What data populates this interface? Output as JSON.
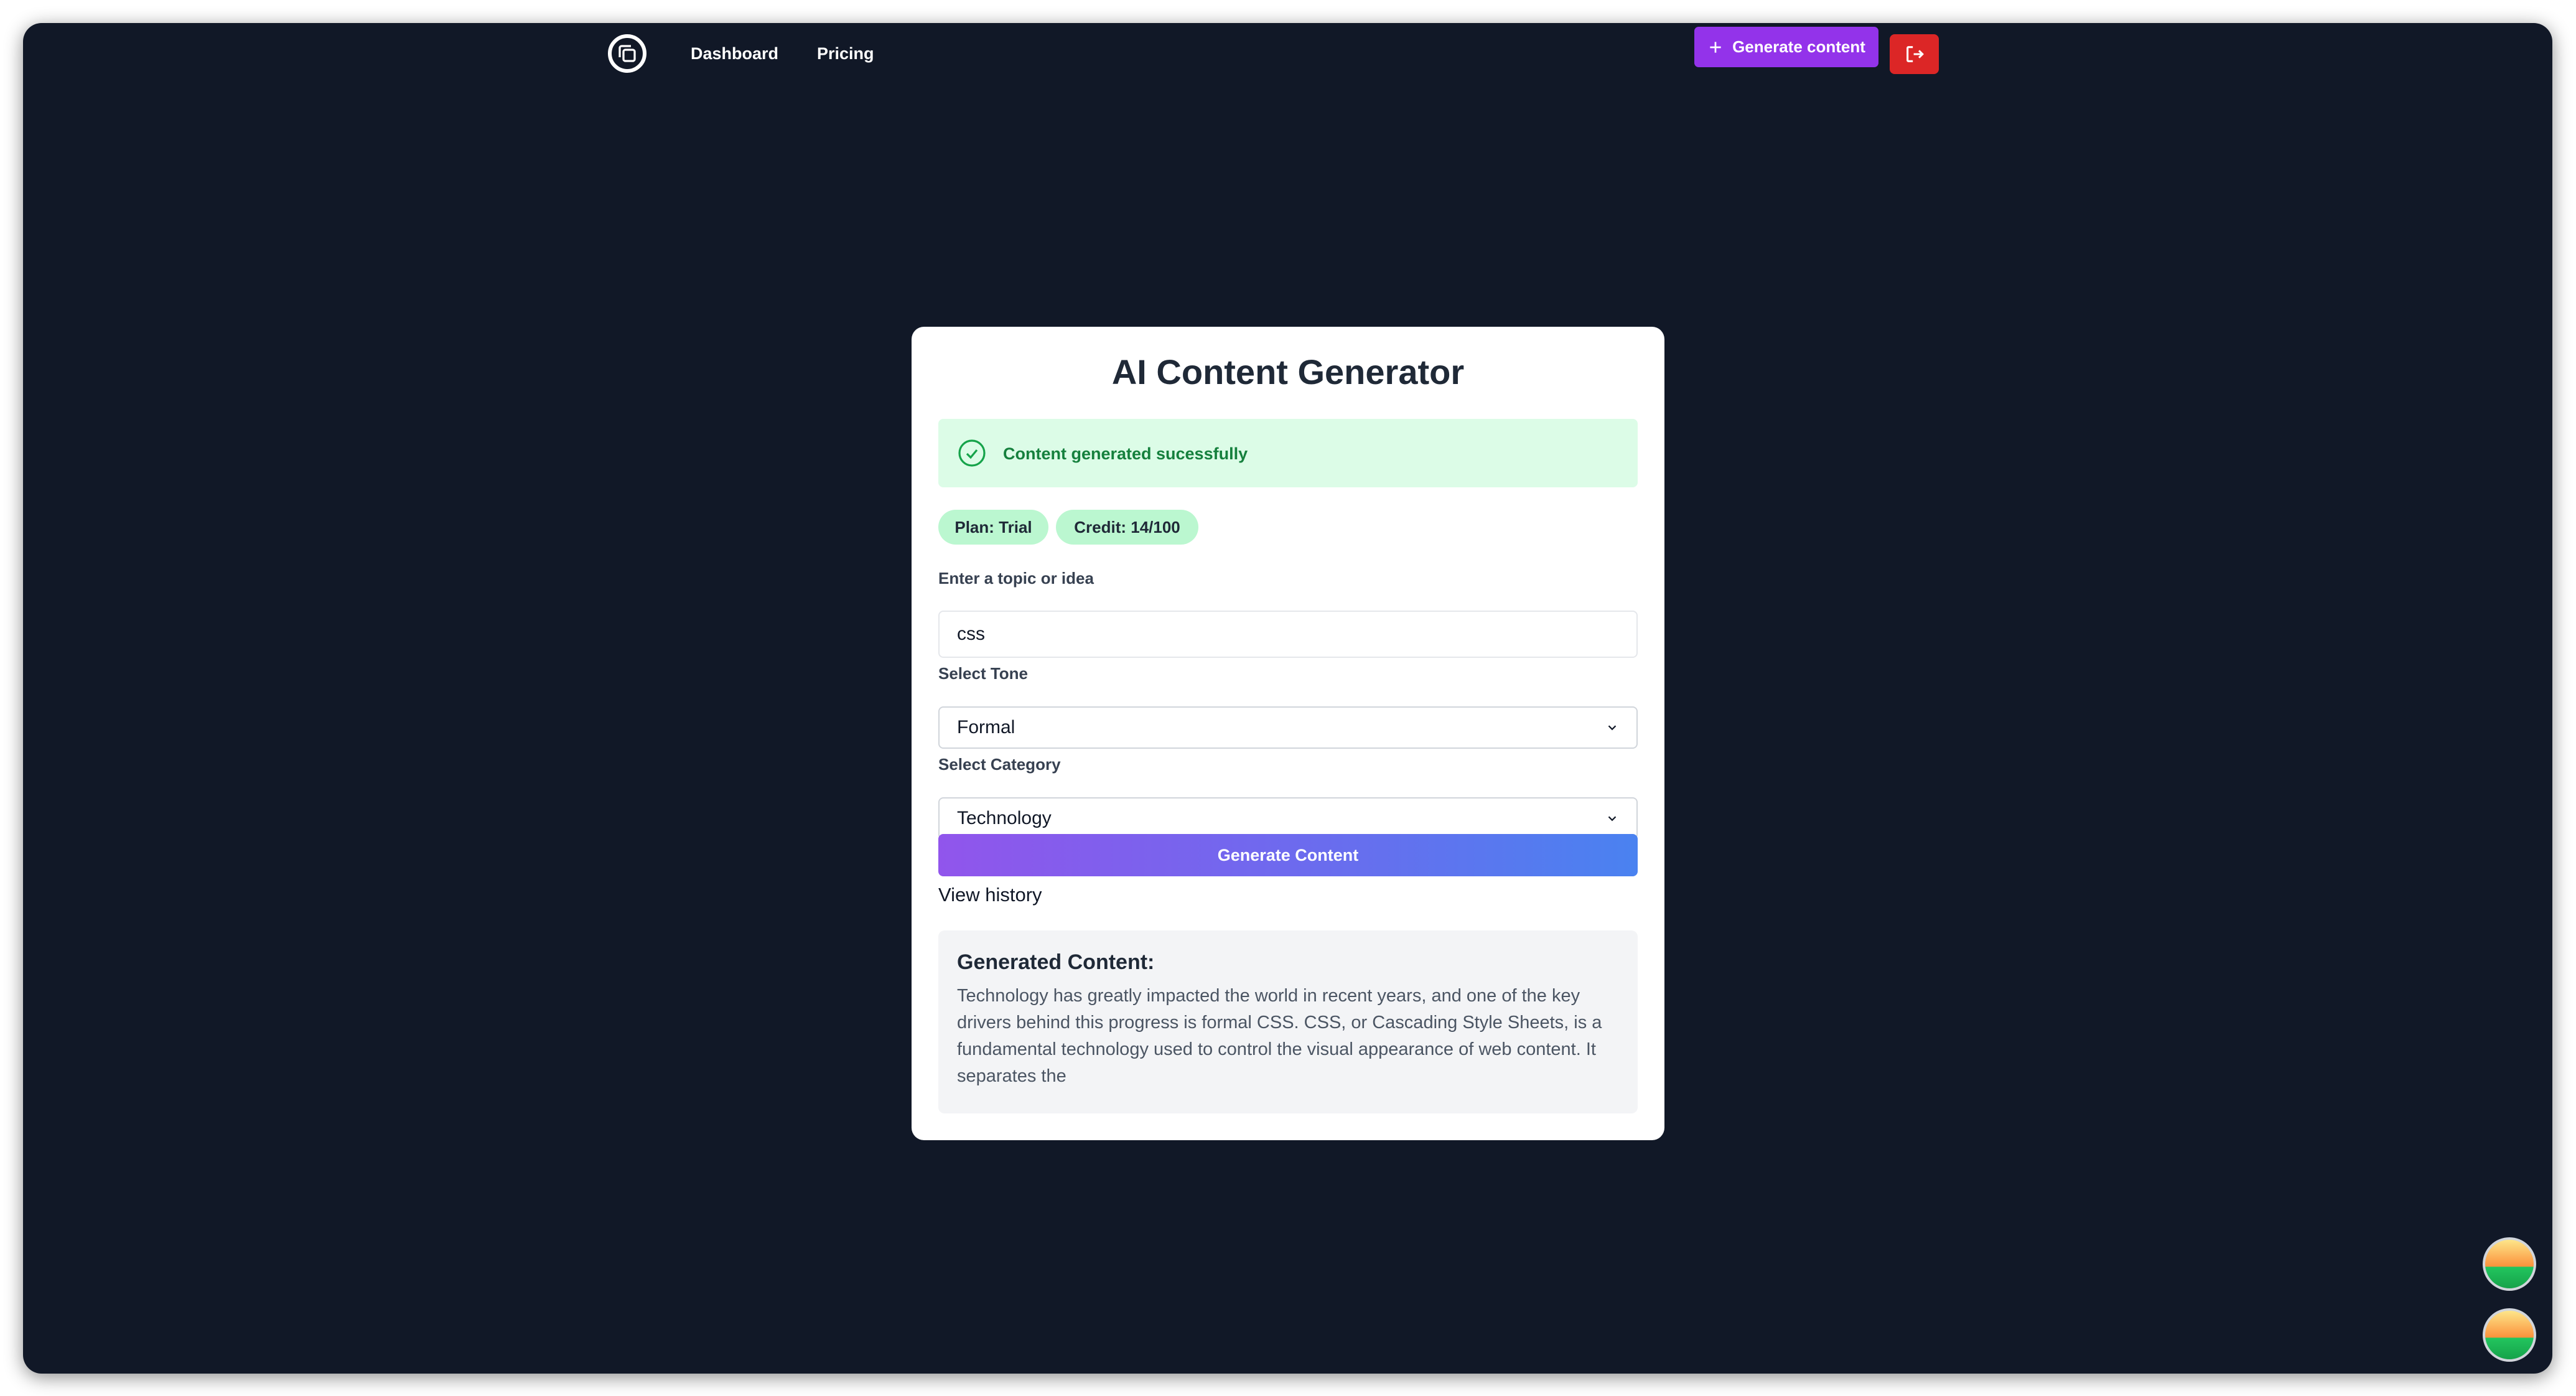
{
  "nav": {
    "links": [
      "Dashboard",
      "Pricing"
    ],
    "generate_button": "Generate content"
  },
  "card": {
    "title": "AI Content Generator",
    "alert": "Content generated sucessfully",
    "badges": {
      "plan": "Plan: Trial",
      "credit": "Credit: 14/100"
    },
    "topic": {
      "label": "Enter a topic or idea",
      "value": "css"
    },
    "tone": {
      "label": "Select Tone",
      "value": "Formal"
    },
    "category": {
      "label": "Select Category",
      "value": "Technology"
    },
    "submit": "Generate Content",
    "history_link": "View history",
    "result": {
      "heading": "Generated Content:",
      "body": "Technology has greatly impacted the world in recent years, and one of the key drivers behind this progress is formal CSS. CSS, or Cascading Style Sheets, is a fundamental technology used to control the visual appearance of web content. It separates the"
    }
  },
  "colors": {
    "background": "#111827",
    "accent": "#9333ea",
    "danger": "#dc2626",
    "success_bg": "#dcfce7",
    "success_text": "#15803d"
  },
  "icons": [
    "copy-logo-icon",
    "plus-icon",
    "logout-icon",
    "check-circle-icon",
    "chevron-down-icon"
  ]
}
